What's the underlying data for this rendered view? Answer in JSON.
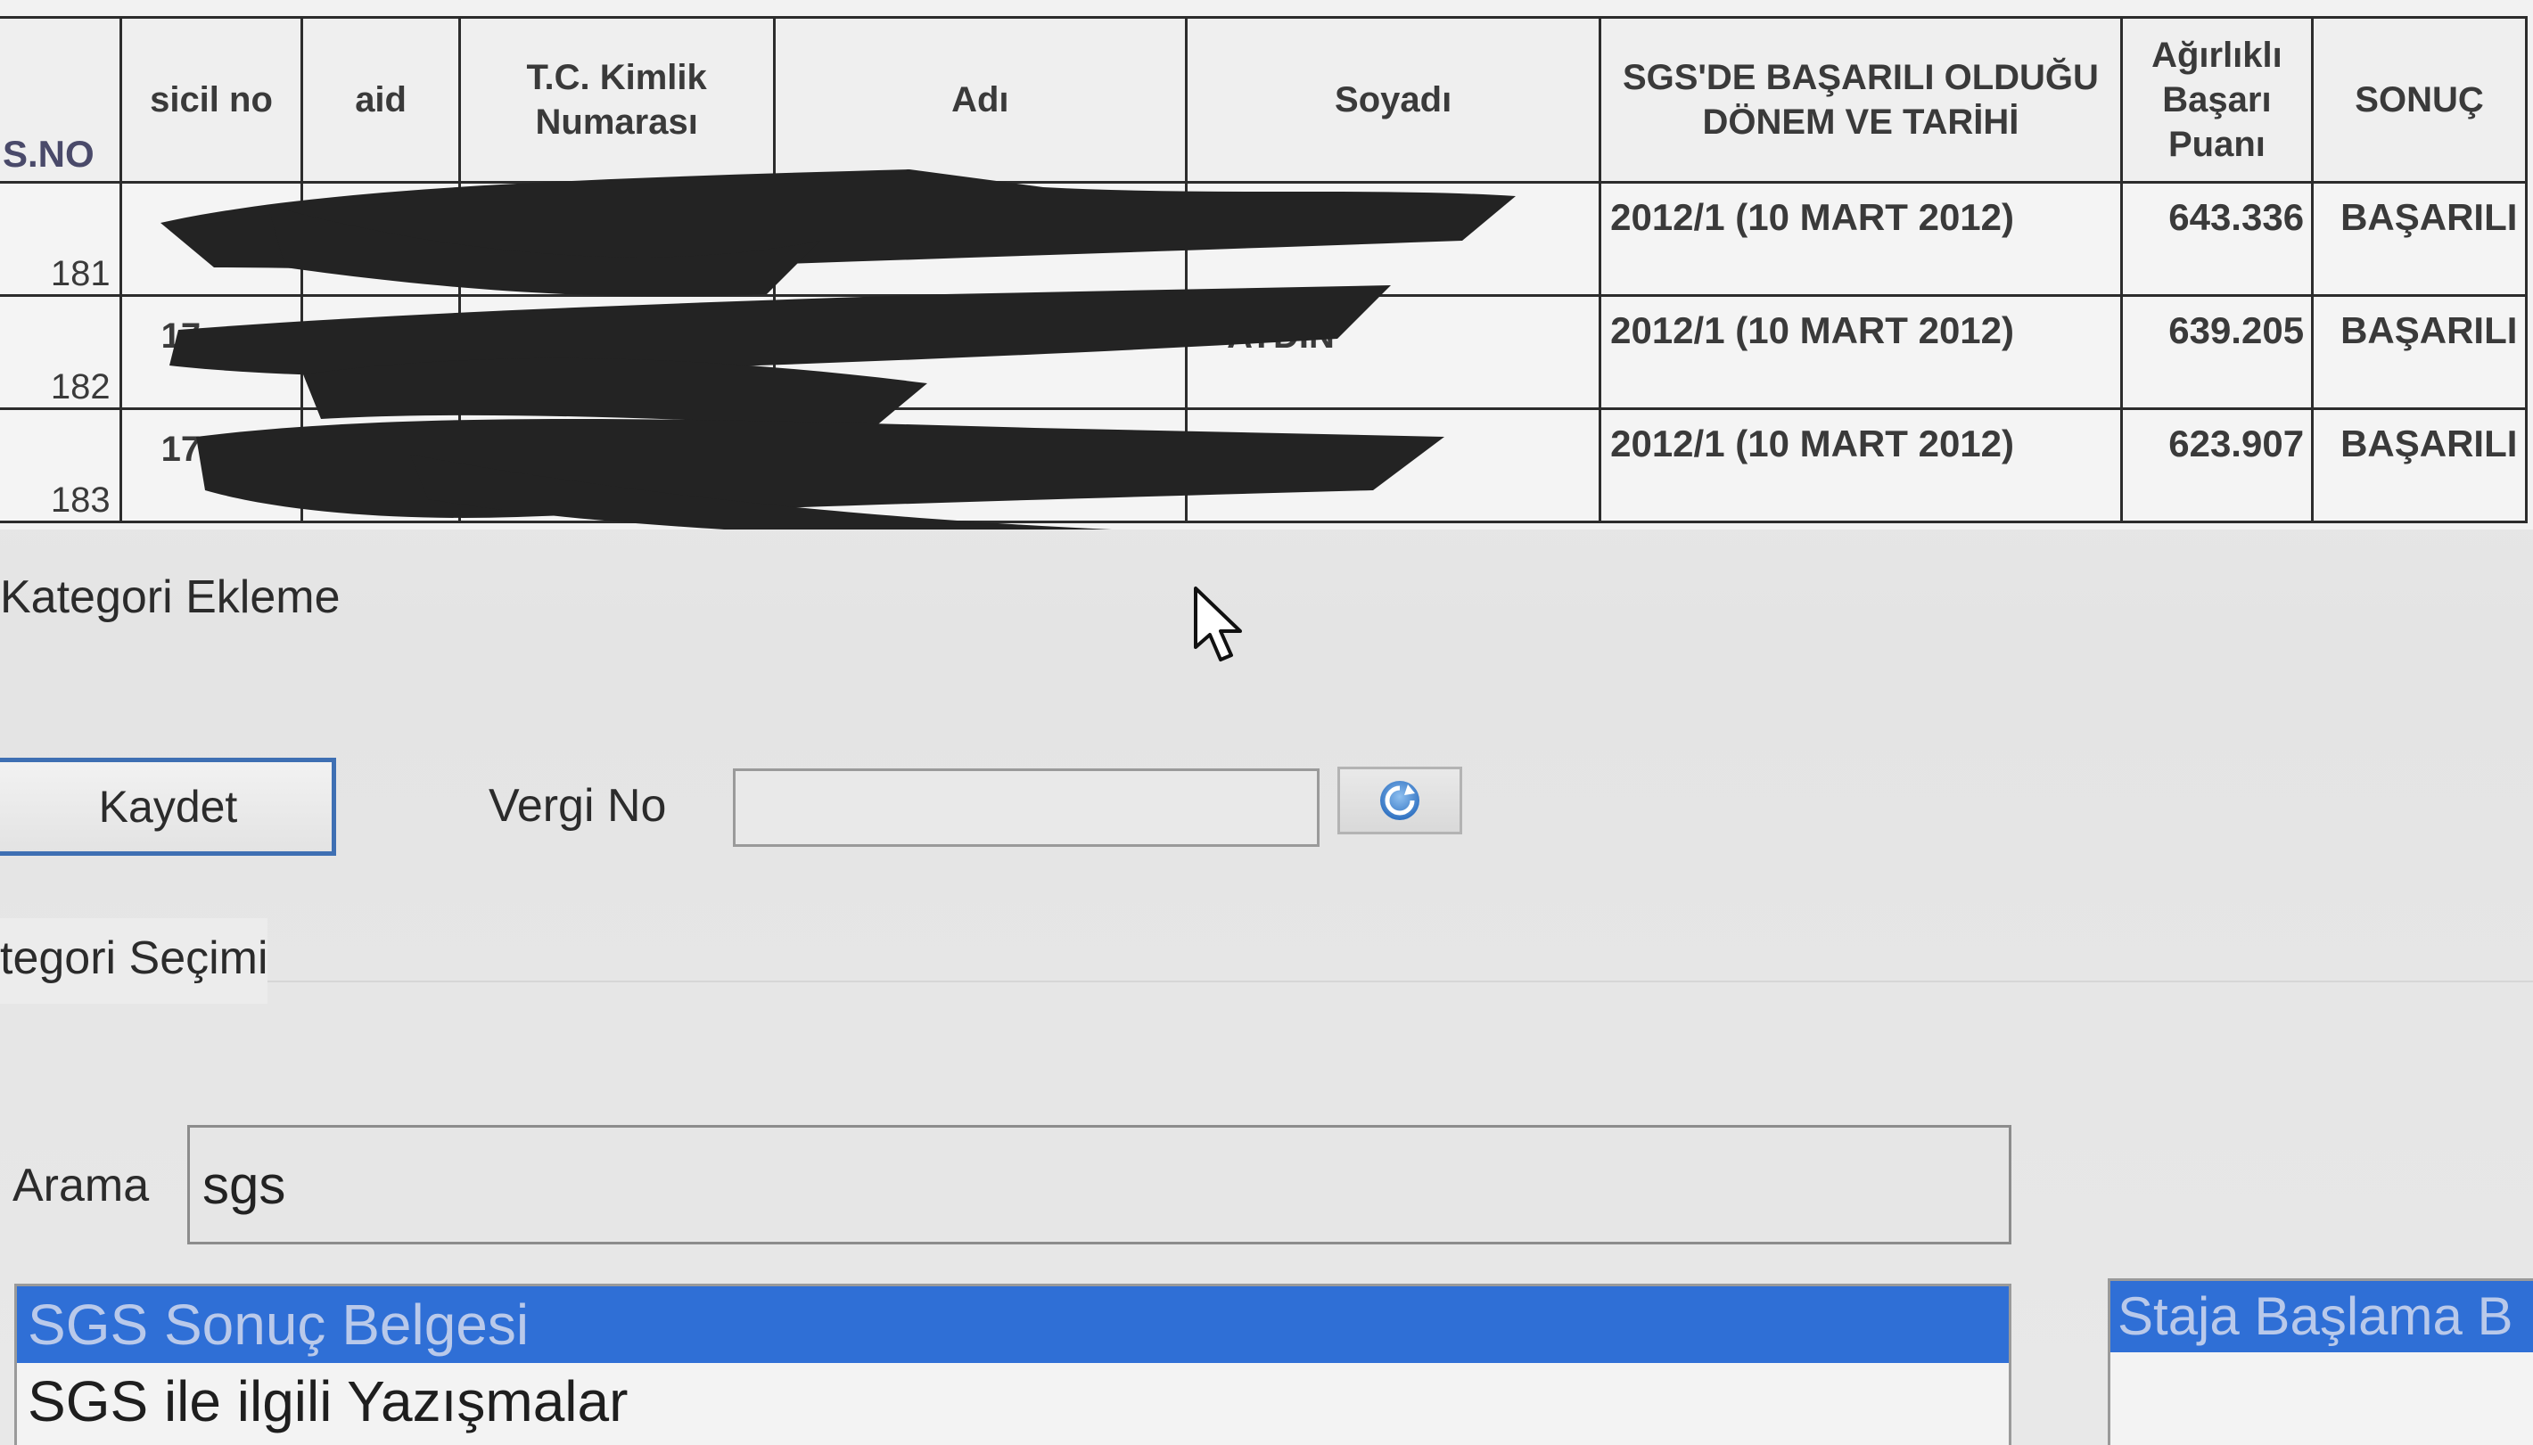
{
  "table": {
    "headers": {
      "sno": "S.NO",
      "sicil": "sicil no",
      "aid": "aid",
      "tc": "T.C. Kimlik Numarası",
      "adi": "Adı",
      "soyadi": "Soyadı",
      "donem": "SGS'DE BAŞARILI OLDUĞU DÖNEM VE TARİHİ",
      "puan": "Ağırlıklı Başarı Puanı",
      "sonuc": "SONUÇ"
    },
    "rows": [
      {
        "sno": "181",
        "sicil": "",
        "soyadi": "",
        "donem": "2012/1 (10 MART 2012)",
        "puan": "643.336",
        "sonuc": "BAŞARILI"
      },
      {
        "sno": "182",
        "sicil": "17",
        "soyadi": "AYDIN",
        "donem": "2012/1 (10 MART 2012)",
        "puan": "639.205",
        "sonuc": "BAŞARILI"
      },
      {
        "sno": "183",
        "sicil": "174",
        "soyadi": "",
        "donem": "2012/1 (10 MART 2012)",
        "puan": "623.907",
        "sonuc": "BAŞARILI"
      }
    ]
  },
  "form": {
    "section_add_title": "Kategori Ekleme",
    "save_label": "Kaydet",
    "vergi_label": "Vergi No",
    "vergi_value": "",
    "section_select_title": "tegori Seçimi",
    "search_label": "Arama",
    "search_value": "sgs"
  },
  "list": {
    "items": [
      "SGS Sonuç Belgesi",
      "SGS ile ilgili Yazışmalar"
    ],
    "selected_index": 0
  },
  "right_list": {
    "items": [
      "Staja Başlama B"
    ]
  },
  "icons": {
    "refresh": "refresh-icon",
    "cursor": "mouse-pointer-icon"
  },
  "colors": {
    "selection": "#2f6fd6",
    "button_border": "#3e6fb3",
    "redaction": "#232323"
  }
}
